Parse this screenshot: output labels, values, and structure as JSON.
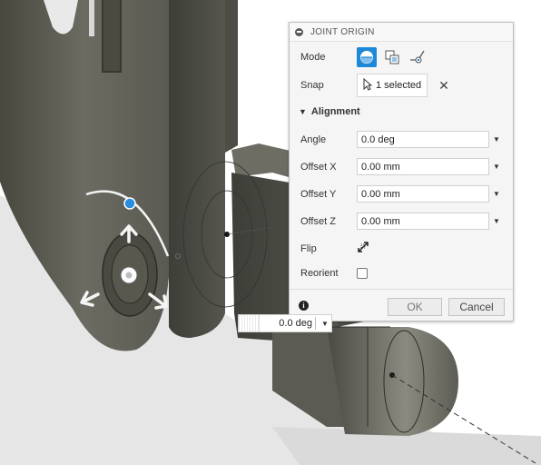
{
  "dialog": {
    "title": "JOINT ORIGIN",
    "mode_label": "Mode",
    "mode_icons": [
      "simple-origin-icon",
      "between-two-faces-icon",
      "two-edge-intersection-icon"
    ],
    "snap_label": "Snap",
    "snap_value": "1 selected",
    "alignment_label": "Alignment",
    "angle_label": "Angle",
    "angle_value": "0.0 deg",
    "offset_x_label": "Offset X",
    "offset_x_value": "0.00 mm",
    "offset_y_label": "Offset Y",
    "offset_y_value": "0.00 mm",
    "offset_z_label": "Offset Z",
    "offset_z_value": "0.00 mm",
    "flip_label": "Flip",
    "reorient_label": "Reorient",
    "reorient_checked": false,
    "ok_label": "OK",
    "cancel_label": "Cancel"
  },
  "canvas_input": {
    "angle_value": "0.0 deg"
  },
  "colors": {
    "accent": "#1e88d8",
    "model_gray": "#5a5a55"
  }
}
